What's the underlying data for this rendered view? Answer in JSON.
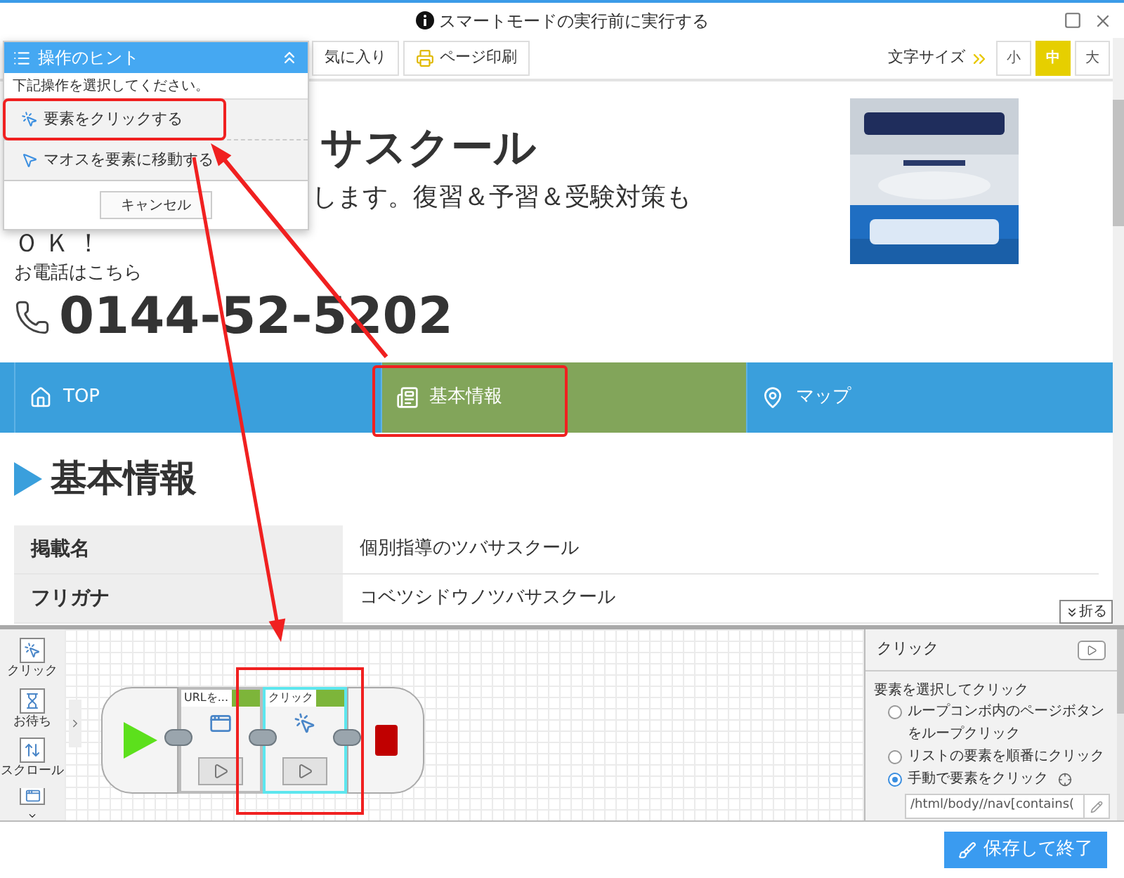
{
  "window": {
    "title": "スマートモードの実行前に実行する"
  },
  "toolbar": {
    "buttons": [
      "気に入り",
      "ページ印刷"
    ],
    "font_size_label": "文字サイズ",
    "font_sizes": [
      {
        "label": "小",
        "selected": false
      },
      {
        "label": "中",
        "selected": true
      },
      {
        "label": "大",
        "selected": false
      }
    ]
  },
  "site": {
    "title": "サスクール",
    "subtitle": "します。復習＆予習＆受験対策も",
    "subtitle_end": "ＯＫ！",
    "phone_label": "お電話はこちら",
    "phone": "0144-52-5202"
  },
  "nav": [
    {
      "label": "TOP",
      "selected": false
    },
    {
      "label": "基本情報",
      "selected": true
    },
    {
      "label": "マップ",
      "selected": false
    }
  ],
  "section": {
    "heading": "基本情報",
    "rows": [
      {
        "label": "掲載名",
        "value": "個別指導のツバサスクール"
      },
      {
        "label": "フリガナ",
        "value": "コベツシドウノツバサスクール"
      }
    ]
  },
  "fold_button": "折る",
  "palette": [
    "クリック",
    "お待ち",
    "スクロール"
  ],
  "flow": {
    "steps": [
      {
        "kind": "start"
      },
      {
        "kind": "open_url",
        "title": "URLを...",
        "selected": false
      },
      {
        "kind": "click",
        "title": "クリック",
        "selected": true
      },
      {
        "kind": "end"
      }
    ]
  },
  "properties": {
    "title": "クリック",
    "section": "要素を選択してクリック",
    "options": [
      {
        "label": "ループコンボ内のページボタンをループクリック",
        "selected": false
      },
      {
        "label": "リストの要素を順番にクリック",
        "selected": false
      },
      {
        "label": "手動で要素をクリック",
        "selected": true
      }
    ],
    "xpath": "/html/body//nav[contains("
  },
  "hint_popup": {
    "title": "操作のヒント",
    "prompt": "下記操作を選択してください。",
    "actions": [
      "要素をクリックする",
      "マオスを要素に移動する"
    ],
    "cancel": "キャンセル"
  },
  "footer": {
    "save_button": "保存して終了"
  }
}
